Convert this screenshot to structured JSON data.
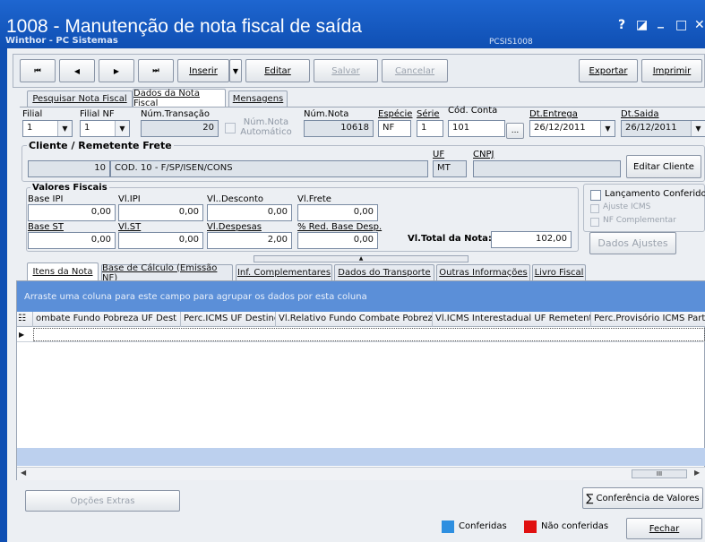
{
  "window": {
    "title": "1008 - Manutenção de nota fiscal de saída",
    "subtitle": "Winthor - PC Sistemas",
    "code": "PCSIS1008",
    "controls": [
      "?",
      "◪",
      "_",
      "□",
      "✕"
    ]
  },
  "toolbar": {
    "first": "⏮",
    "prev": "◀",
    "next": "▶",
    "last": "⏭",
    "inserir": "Inserir",
    "editar": "Editar",
    "salvar": "Salvar",
    "cancelar": "Cancelar",
    "exportar": "Exportar",
    "imprimir": "Imprimir"
  },
  "tabs": [
    "Pesquisar Nota Fiscal",
    "Dados da Nota Fiscal",
    "Mensagens"
  ],
  "header_fields": {
    "filial_label": "Filial",
    "filial": "1",
    "filial_nf_label": "Filial NF",
    "filial_nf": "1",
    "num_transacao_label": "Núm.Transação",
    "num_transacao": "20",
    "num_nota_auto": "Núm.Nota Automático",
    "num_nota_label": "Núm.Nota",
    "num_nota": "10618",
    "especie_label": "Espécie",
    "especie": "NF",
    "serie_label": "Série",
    "serie": "1",
    "cod_conta_label": "Cód. Conta",
    "cod_conta": "101",
    "cod_conta_btn": "...",
    "dt_entrega_label": "Dt.Entrega",
    "dt_entrega": "26/12/2011",
    "dt_saida_label": "Dt.Saida",
    "dt_saida": "26/12/2011"
  },
  "cliente": {
    "title": "Cliente / Remetente Frete",
    "codigo": "10",
    "descricao": "COD. 10 - F/SP/ISEN/CONS",
    "uf_label": "UF",
    "uf": "MT",
    "cnpj_label": "CNPJ",
    "cnpj": "",
    "editar_btn": "Editar Cliente"
  },
  "valores": {
    "title": "Valores Fiscais",
    "base_ipi_label": "Base IPI",
    "base_ipi": "0,00",
    "vl_ipi_label": "Vl.IPI",
    "vl_ipi": "0,00",
    "vl_desconto_label": "Vl..Desconto",
    "vl_desconto": "0,00",
    "vl_frete_label": "Vl.Frete",
    "vl_frete": "0,00",
    "base_st_label": "Base ST",
    "base_st": "0,00",
    "vl_st_label": "Vl.ST",
    "vl_st": "0,00",
    "vl_despesas_label": "Vl.Despesas",
    "vl_despesas": "2,00",
    "red_base_label": "% Red. Base Desp.",
    "red_base": "0,00",
    "total_label": "Vl.Total da Nota:",
    "total": "102,00"
  },
  "checks": {
    "lancamento": "Lançamento Conferido",
    "ajuste_icms": "Ajuste ICMS",
    "nf_complementar": "NF Complementar",
    "dados_ajustes": "Dados Ajustes"
  },
  "subtabs": [
    "Itens da Nota",
    "Base de Cálculo (Emissão NF)",
    "Inf. Complementares",
    "Dados do Transporte",
    "Outras Informações",
    "Livro Fiscal"
  ],
  "grid": {
    "group_hint": "Arraste uma coluna para este campo para agrupar os dados por esta coluna",
    "columns": [
      "ombate Fundo Pobreza UF Dest",
      "Perc.ICMS UF Destino",
      "Vl.Relativo Fundo Combate Pobreza",
      "Vl.ICMS Interestadual UF Remetente",
      "Perc.Provisório ICMS Partilha"
    ]
  },
  "footer": {
    "opcoes_extras": "Opções Extras",
    "conferencia": "Conferência de Valores",
    "legend_conferidas": "Conferidas",
    "legend_nao": "Não conferidas",
    "fechar": "Fechar",
    "conferidas_color": "#2e8fe0",
    "nao_color": "#e01010",
    "scroll_thumb": "III"
  }
}
